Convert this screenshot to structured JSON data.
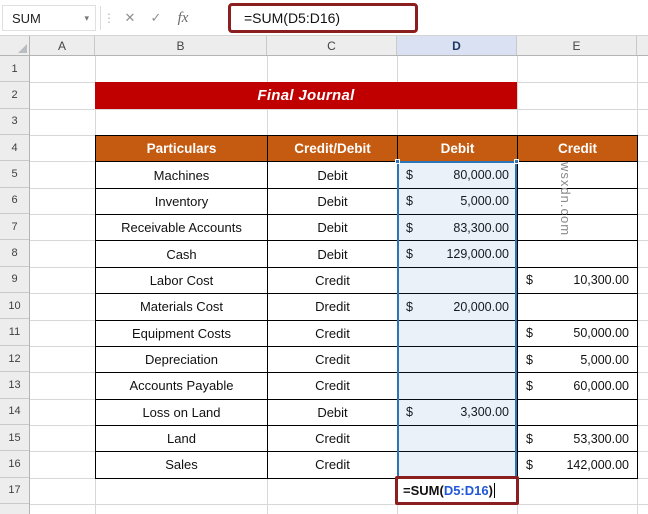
{
  "formula_bar": {
    "name_box_value": "SUM",
    "name_box_dropdown": "▾",
    "menu_dots": "⋮",
    "cancel_label": "✕",
    "enter_label": "✓",
    "fx_label": "fx",
    "formula_text": "=SUM(D5:D16)"
  },
  "sheet": {
    "column_letters": [
      "A",
      "B",
      "C",
      "D",
      "E"
    ],
    "row_numbers": [
      1,
      2,
      3,
      4,
      5,
      6,
      7,
      8,
      9,
      10,
      11,
      12,
      13,
      14,
      15,
      16,
      17
    ],
    "selected_column_letter": "D"
  },
  "title_banner": {
    "text": "Final Journal"
  },
  "journal_table": {
    "columns": [
      "Particulars",
      "Credit/Debit",
      "Debit",
      "Credit"
    ],
    "currency_symbol": "$",
    "rows": [
      {
        "particulars": "Machines",
        "entry_type": "Debit",
        "debit": "80,000.00",
        "credit": ""
      },
      {
        "particulars": "Inventory",
        "entry_type": "Debit",
        "debit": "5,000.00",
        "credit": ""
      },
      {
        "particulars": "Receivable Accounts",
        "entry_type": "Debit",
        "debit": "83,300.00",
        "credit": ""
      },
      {
        "particulars": "Cash",
        "entry_type": "Debit",
        "debit": "129,000.00",
        "credit": ""
      },
      {
        "particulars": "Labor Cost",
        "entry_type": "Credit",
        "debit": "",
        "credit": "10,300.00"
      },
      {
        "particulars": "Materials Cost",
        "entry_type": "Dredit",
        "debit": "20,000.00",
        "credit": ""
      },
      {
        "particulars": "Equipment Costs",
        "entry_type": "Credit",
        "debit": "",
        "credit": "50,000.00"
      },
      {
        "particulars": "Depreciation",
        "entry_type": "Credit",
        "debit": "",
        "credit": "5,000.00"
      },
      {
        "particulars": "Accounts Payable",
        "entry_type": "Credit",
        "debit": "",
        "credit": "60,000.00"
      },
      {
        "particulars": "Loss on Land",
        "entry_type": "Debit",
        "debit": "3,300.00",
        "credit": ""
      },
      {
        "particulars": "Land",
        "entry_type": "Credit",
        "debit": "",
        "credit": "53,300.00"
      },
      {
        "particulars": "Sales",
        "entry_type": "Credit",
        "debit": "",
        "credit": "142,000.00"
      }
    ]
  },
  "active_cell": {
    "cell_ref": "D17",
    "formula_prefix": "=SUM(",
    "formula_range": "D5:D16",
    "formula_suffix": ")"
  },
  "watermark_text": "wsxdn.com",
  "colors": {
    "banner_bg": "#C00000",
    "table_header_bg": "#C55A11",
    "selection_border": "#2E75B6",
    "formula_box_border": "#8B1F1F",
    "range_reference_text": "#2057D6"
  }
}
